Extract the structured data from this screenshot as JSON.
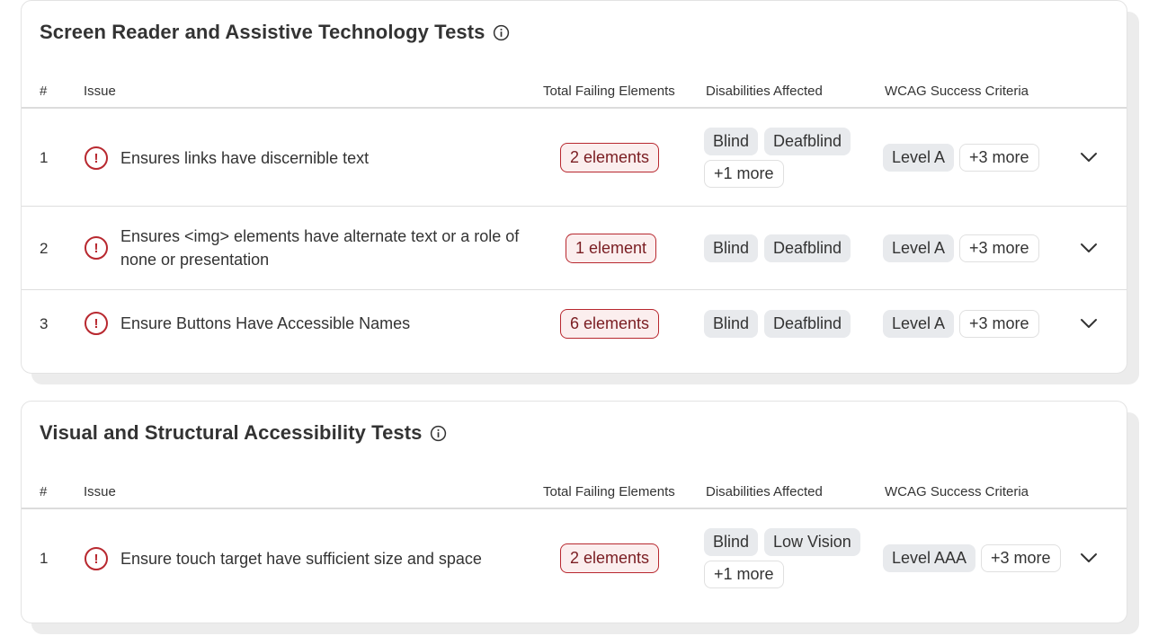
{
  "headers": {
    "num": "#",
    "issue": "Issue",
    "failing": "Total Failing Elements",
    "disabilities": "Disabilities Affected",
    "wcag": "WCAG Success Criteria"
  },
  "sections": [
    {
      "title": "Screen Reader and Assistive Technology Tests",
      "rows": [
        {
          "num": "1",
          "issue": "Ensures links have discernible text",
          "failing": "2 elements",
          "disabilities": [
            "Blind",
            "Deafblind"
          ],
          "disabilities_more": "+1 more",
          "wcag": "Level A",
          "wcag_more": "+3 more"
        },
        {
          "num": "2",
          "issue": "Ensures <img> elements have alternate text or a role of none or presentation",
          "failing": "1 element",
          "disabilities": [
            "Blind",
            "Deafblind"
          ],
          "disabilities_more": "",
          "wcag": "Level A",
          "wcag_more": "+3 more"
        },
        {
          "num": "3",
          "issue": "Ensure Buttons Have Accessible Names",
          "failing": "6 elements",
          "disabilities": [
            "Blind",
            "Deafblind"
          ],
          "disabilities_more": "",
          "wcag": "Level A",
          "wcag_more": "+3 more"
        }
      ]
    },
    {
      "title": "Visual and Structural Accessibility Tests",
      "rows": [
        {
          "num": "1",
          "issue": "Ensure touch target have sufficient size and space",
          "failing": "2 elements",
          "disabilities": [
            "Blind",
            "Low Vision"
          ],
          "disabilities_more": "+1 more",
          "wcag": "Level AAA",
          "wcag_more": "+3 more"
        }
      ]
    }
  ],
  "icons": {
    "info": "info-circle-icon",
    "warning": "exclamation-circle-icon",
    "expand": "chevron-down-icon"
  },
  "colors": {
    "error": "#b8282f",
    "error_bg": "#fbeeee",
    "chip_bg": "#e8eaed"
  }
}
